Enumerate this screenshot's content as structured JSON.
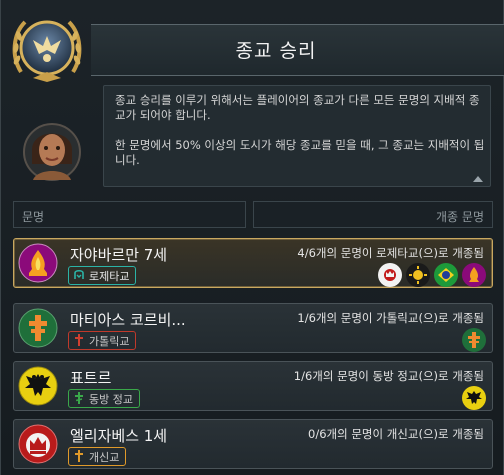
{
  "header": {
    "title": "종교 승리"
  },
  "advisor": {
    "paragraph1": "종교 승리를 이루기 위해서는 플레이어의 종교가 다른 모든 문명의 지배적 종교가 되어야 합니다.",
    "paragraph2": "한 문명에서 50% 이상의 도시가 해당 종교를 믿을 때, 그 종교는 지배적이 됩니다."
  },
  "columns": {
    "civilization": "문명",
    "converted": "개종 문명"
  },
  "rows": [
    {
      "name": "자야바르만 7세",
      "status": "4/6개의 문명이 로제타교(으)로 개종됨",
      "religion": "로제타교",
      "accent": "#8b0a7a",
      "badge_color": "#2bb3a6",
      "selected": true,
      "icons": [
        "red-crown-icon",
        "yellow-sun-icon",
        "green-globe-icon",
        "purple-flame-icon"
      ]
    },
    {
      "name": "마티아스 코르비...",
      "status": "1/6개의 문명이 가톨릭교(으)로 개종됨",
      "religion": "가톨릭교",
      "accent": "#1f6f3a",
      "badge_color": "#c0392b",
      "selected": false,
      "icons": [
        "orange-cross-icon"
      ]
    },
    {
      "name": "표트르",
      "status": "1/6개의 문명이 동방 정교(으)로 개종됨",
      "religion": "동방 정교",
      "accent": "#c9b400",
      "badge_color": "#3aa84a",
      "selected": false,
      "icons": [
        "eagle-icon"
      ]
    },
    {
      "name": "엘리자베스 1세",
      "status": "0/6개의 문명이 개신교(으)로 개종됨",
      "religion": "개신교",
      "accent": "#b81b1b",
      "badge_color": "#e09a2a",
      "selected": false,
      "icons": []
    }
  ]
}
